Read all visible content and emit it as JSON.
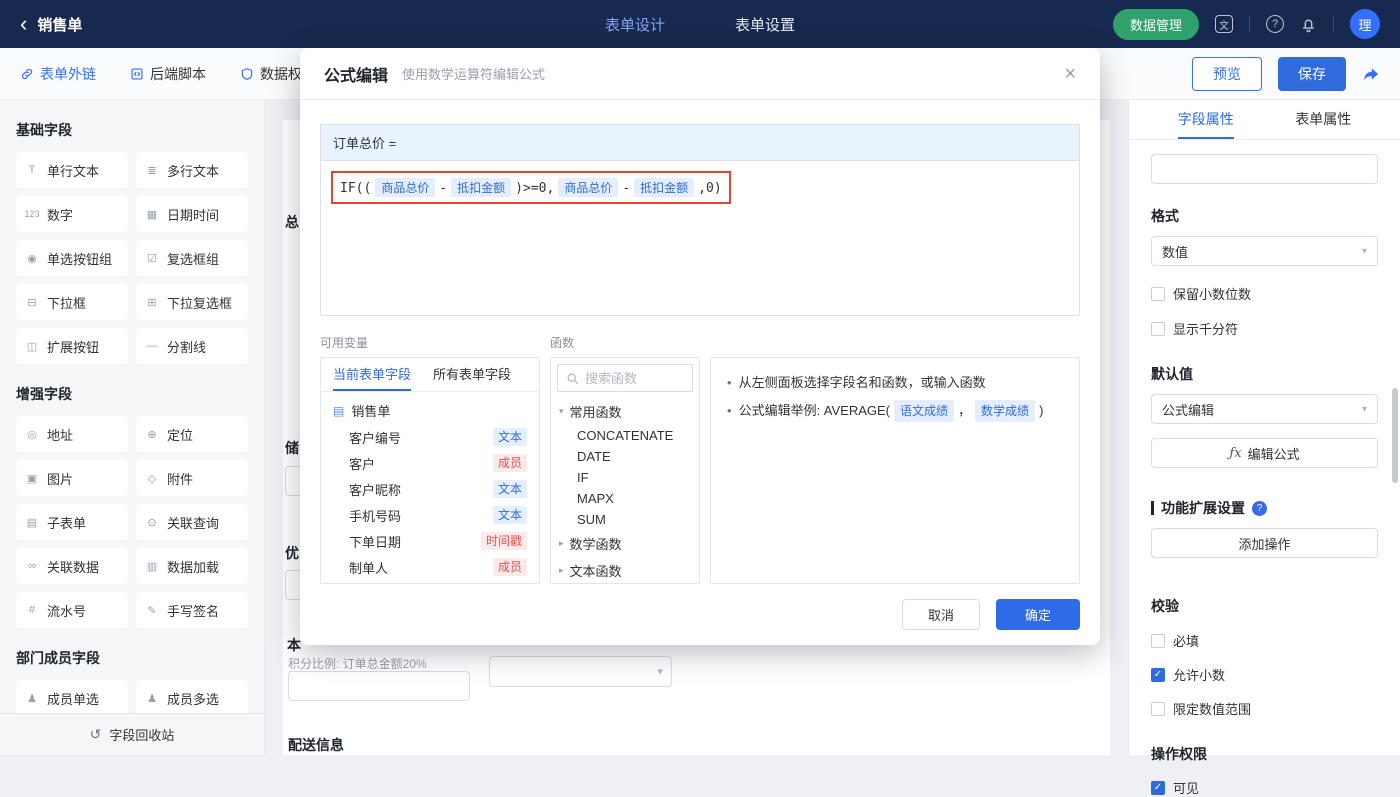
{
  "topbar": {
    "title": "销售单",
    "nav_design": "表单设计",
    "nav_settings": "表单设置",
    "data_manage": "数据管理",
    "avatar": "理"
  },
  "toolbar": {
    "form_link": "表单外链",
    "backend_script": "后端脚本",
    "data_perm": "数据权",
    "preview": "预览",
    "save": "保存"
  },
  "sidebar": {
    "section_basic": "基础字段",
    "basic": [
      {
        "icon": "T",
        "label": "单行文本"
      },
      {
        "icon": "≣",
        "label": "多行文本"
      },
      {
        "icon": "123",
        "label": "数字"
      },
      {
        "icon": "▦",
        "label": "日期时间"
      },
      {
        "icon": "◉",
        "label": "单选按钮组"
      },
      {
        "icon": "☑",
        "label": "复选框组"
      },
      {
        "icon": "⊟",
        "label": "下拉框"
      },
      {
        "icon": "⊞",
        "label": "下拉复选框"
      },
      {
        "icon": "◫",
        "label": "扩展按钮"
      },
      {
        "icon": "—",
        "label": "分割线"
      }
    ],
    "section_enhanced": "增强字段",
    "enhanced": [
      {
        "icon": "◎",
        "label": "地址"
      },
      {
        "icon": "⊕",
        "label": "定位"
      },
      {
        "icon": "▣",
        "label": "图片"
      },
      {
        "icon": "◇",
        "label": "附件"
      },
      {
        "icon": "▤",
        "label": "子表单"
      },
      {
        "icon": "⊙",
        "label": "关联查询"
      },
      {
        "icon": "∞",
        "label": "关联数据"
      },
      {
        "icon": "▥",
        "label": "数据加载"
      },
      {
        "icon": "#",
        "label": "流水号"
      },
      {
        "icon": "✎",
        "label": "手写签名"
      }
    ],
    "section_member": "部门成员字段",
    "member": [
      {
        "icon": "♟",
        "label": "成员单选"
      },
      {
        "icon": "♟",
        "label": "成员多选"
      }
    ],
    "recycle": "字段回收站"
  },
  "canvas": {
    "frag1": "总",
    "frag2": "储",
    "frag3": "优",
    "frag4": "本",
    "points_note": "积分比例: 订单总金额20%",
    "delivery": "配送信息"
  },
  "modal": {
    "title": "公式编辑",
    "subtitle": "使用数学运算符编辑公式",
    "target": "订单总价 =",
    "formula": [
      {
        "v": "IF(("
      },
      {
        "v": "商品总价"
      },
      {
        "v": "-"
      },
      {
        "v": "抵扣金额"
      },
      {
        "v": ")>=0,"
      },
      {
        "v": "商品总价"
      },
      {
        "v": "-"
      },
      {
        "v": "抵扣金额"
      },
      {
        "v": ",0)"
      }
    ],
    "vars_label": "可用变量",
    "funcs_label": "函数",
    "tab_current": "当前表单字段",
    "tab_all": "所有表单字段",
    "form_name": "销售单",
    "variables": [
      {
        "name": "客户编号",
        "tag": "文本"
      },
      {
        "name": "客户",
        "tag": "成员"
      },
      {
        "name": "客户昵称",
        "tag": "文本"
      },
      {
        "name": "手机号码",
        "tag": "文本"
      },
      {
        "name": "下单日期",
        "tag": "时间戳"
      },
      {
        "name": "制单人",
        "tag": "成员"
      }
    ],
    "search_placeholder": "搜索函数",
    "group_common": "常用函数",
    "funcs": [
      "CONCATENATE",
      "DATE",
      "IF",
      "MAPX",
      "SUM"
    ],
    "group_math": "数学函数",
    "group_text": "文本函数",
    "tip1": "从左侧面板选择字段名和函数，或输入函数",
    "tip2_prefix": "公式编辑举例: AVERAGE(",
    "tip2_chip1": "语文成绩",
    "tip2_comma": "，",
    "tip2_chip2": "数学成绩",
    "tip2_suffix": ")",
    "cancel": "取消",
    "ok": "确定"
  },
  "panel": {
    "tab_field": "字段属性",
    "tab_form": "表单属性",
    "format_label": "格式",
    "format_value": "数值",
    "chk_decimal": "保留小数位数",
    "chk_thousand": "显示千分符",
    "default_label": "默认值",
    "default_value": "公式编辑",
    "edit_formula": "编辑公式",
    "ext_label": "功能扩展设置",
    "add_action": "添加操作",
    "validate_label": "校验",
    "chk_required": "必填",
    "chk_allow_decimal": "允许小数",
    "chk_range": "限定数值范围",
    "perm_label": "操作权限",
    "chk_visible": "可见"
  },
  "icons": {
    "back": "‹",
    "chevron_down": "▾",
    "chevron_right": "▸",
    "close": "×",
    "question": "?",
    "translate": "文",
    "bullet": "•",
    "fx": "ƒx",
    "recycle": "↺",
    "check": "✓"
  }
}
